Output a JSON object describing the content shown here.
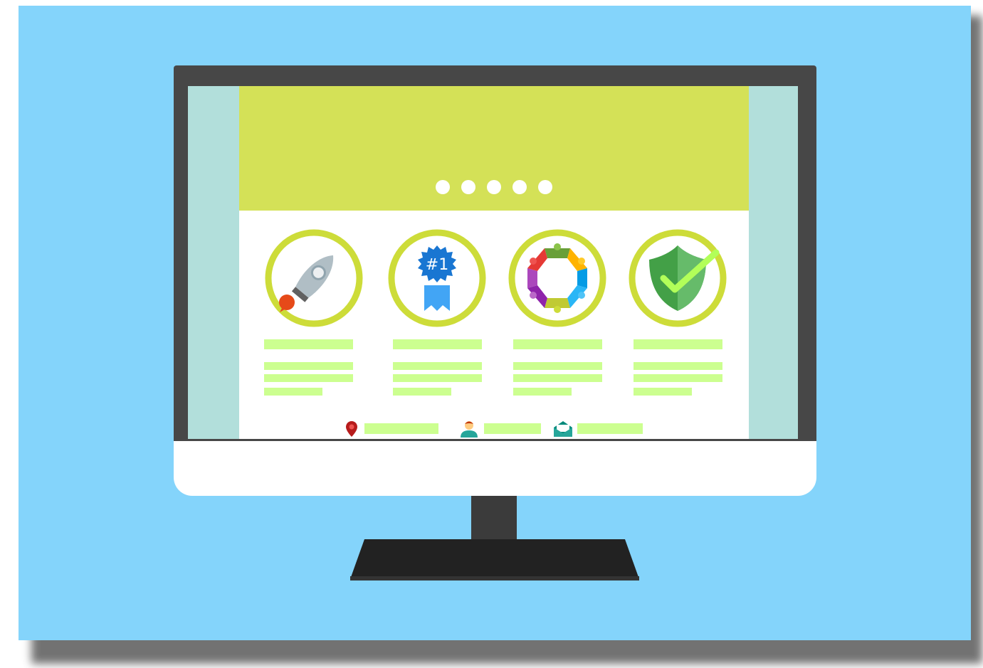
{
  "colors": {
    "background": "#84d4fb",
    "hero": "#d4e157",
    "ring": "#cddc39",
    "text_bar": "#ccff90",
    "monitor_frame": "#474747",
    "sidebar": "#b2dfdb"
  },
  "monitor": {
    "slider_dots": 5,
    "features": [
      {
        "icon": "rocket-icon"
      },
      {
        "icon": "award-ribbon-icon",
        "badge_text": "#1"
      },
      {
        "icon": "team-circle-icon"
      },
      {
        "icon": "shield-check-icon"
      }
    ],
    "contacts": [
      {
        "icon": "location-pin-icon"
      },
      {
        "icon": "user-icon"
      },
      {
        "icon": "mail-icon"
      }
    ]
  }
}
